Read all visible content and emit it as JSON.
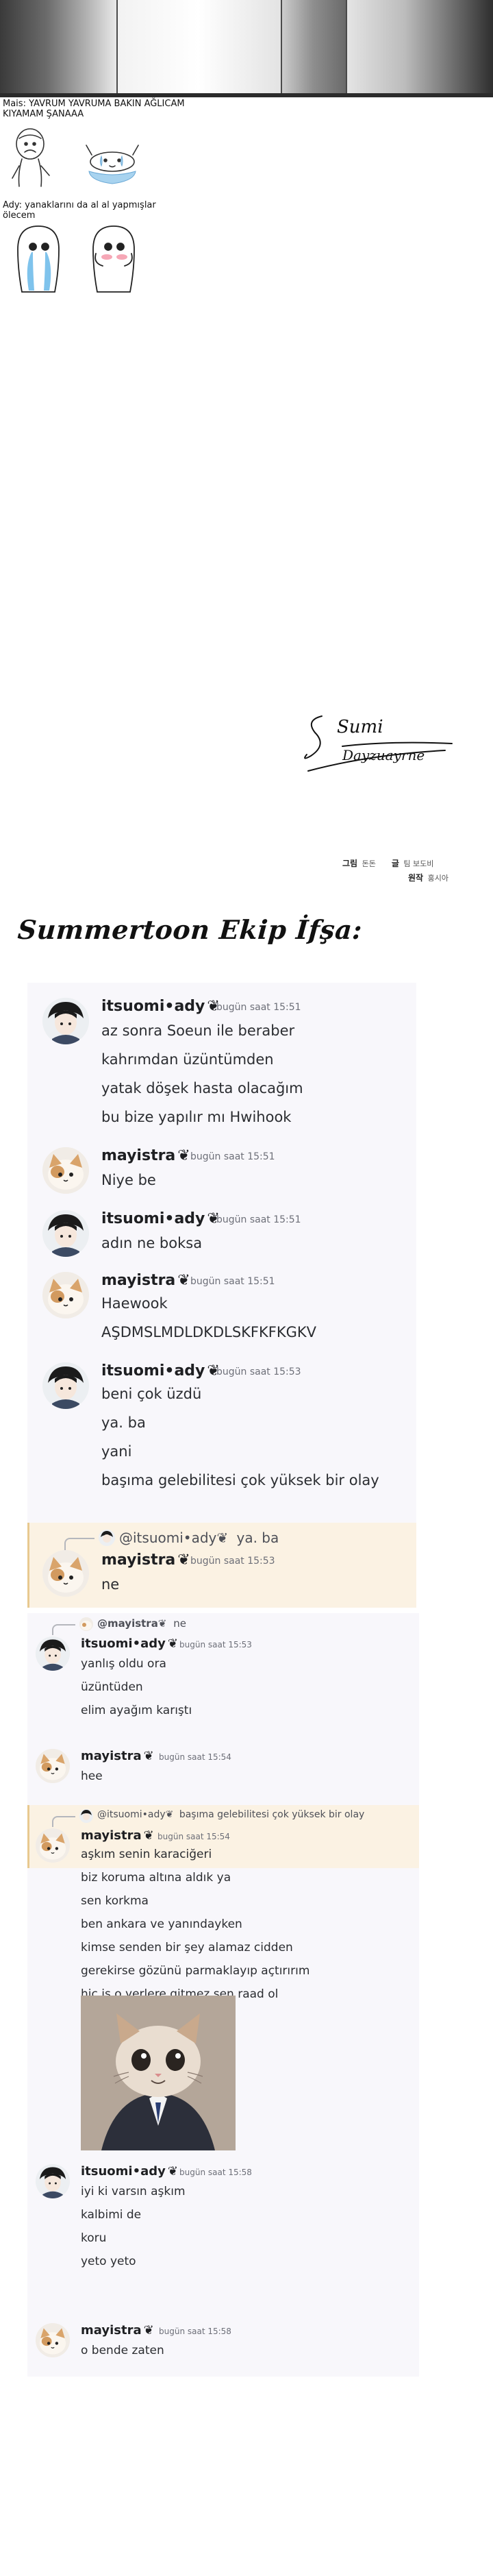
{
  "notes": {
    "note1_line1": "Mais: YAVRUM YAVRUMA BAKIN AĞLICAM",
    "note1_line2": "KIYAMAM ŞANAAA",
    "note2_line1": "Ady: yanaklarını da al al yapmışlar",
    "note2_line2": "ölecem"
  },
  "signature": {
    "line1": "Sumi",
    "line2": "Dayzuayrne"
  },
  "credits": [
    {
      "role": "그림",
      "name": "돈돈"
    },
    {
      "role": "글",
      "name": "팀 보도비"
    },
    {
      "role": "원작",
      "name": "홍시아"
    }
  ],
  "title": "Summertoon Ekip İfşa:",
  "user_emoji": "❦",
  "chat_a": {
    "messages": [
      {
        "user": "itsuomi•ady",
        "time": "bugün saat 15:51",
        "lines": [
          "az sonra Soeun ile beraber",
          "kahrımdan üzüntümden",
          "yatak döşek hasta olacağım",
          "bu bize yapılır mı Hwihook"
        ]
      },
      {
        "user": "mayistra",
        "time": "bugün saat 15:51",
        "lines": [
          "Niye be"
        ]
      },
      {
        "user": "itsuomi•ady",
        "time": "bugün saat 15:51",
        "lines": [
          "adın ne boksa"
        ]
      },
      {
        "user": "mayistra",
        "time": "bugün saat 15:51",
        "lines": [
          "Haewook",
          "AŞDMSLMDLDKDLSKFKFKGKV"
        ]
      },
      {
        "user": "itsuomi•ady",
        "time": "bugün saat 15:53",
        "lines": [
          "beni çok üzdü",
          "ya. ba",
          "yani",
          "başıma gelebilitesi çok yüksek bir olay"
        ]
      },
      {
        "user": "mayistra",
        "time": "bugün saat 15:53",
        "lines": [
          "ne"
        ],
        "reply_to": "@itsuomi•ady",
        "reply_text": "ya. ba"
      }
    ]
  },
  "chat_b": {
    "messages": [
      {
        "user": "itsuomi•ady",
        "time": "bugün saat 15:53",
        "lines": [
          "yanlış oldu ora",
          "üzüntüden",
          "elim ayağım karıştı"
        ],
        "reply_to": "@mayistra",
        "reply_text": "ne"
      },
      {
        "user": "mayistra",
        "time": "bugün saat 15:54",
        "lines": [
          "hee"
        ]
      },
      {
        "user": "mayistra",
        "time": "bugün saat 15:54",
        "lines": [
          "aşkım senin karaciğeri",
          "biz koruma altına aldık ya",
          "sen korkma",
          "ben ankara ve yanındayken",
          "kimse senden bir şey alamaz cidden",
          "gerekirse gözünü parmaklayıp açtırırım",
          "hiç iş o yerlere gitmez sen raad ol"
        ],
        "reply_to": "@itsuomi•ady",
        "reply_text": "başıma gelebilitesi çok yüksek bir olay"
      },
      {
        "user": "itsuomi•ady",
        "time": "bugün saat 15:58",
        "lines": [
          "iyi ki varsın aşkım",
          "kalbimi de",
          "koru",
          "yeto yeto"
        ]
      },
      {
        "user": "mayistra",
        "time": "bugün saat 15:58",
        "lines": [
          "o bende zaten"
        ]
      }
    ]
  },
  "colors": {
    "card_bg": "#f8f7fb",
    "highlight_bg": "#fbf2e3",
    "username": "#1e1f22",
    "timestamp": "#6d6f78"
  }
}
